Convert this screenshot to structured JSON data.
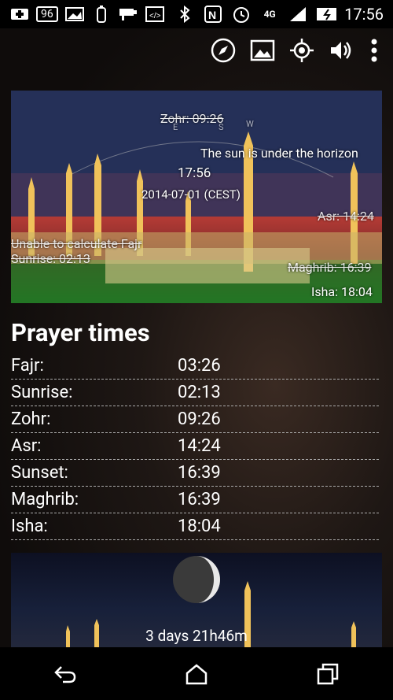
{
  "status_bar": {
    "battery_level": "96",
    "network": "4G",
    "time": "17:56",
    "icons": [
      "plus-icon",
      "battery-level-icon",
      "image-icon",
      "battery-icon",
      "cctv-icon",
      "code-icon",
      "bluetooth-icon",
      "nfc-icon",
      "alarm-icon",
      "network-4g-icon",
      "signal-icon",
      "battery-charging-icon"
    ]
  },
  "action_bar": {
    "icons": [
      "compass-icon",
      "image-icon",
      "location-icon",
      "volume-icon",
      "overflow-menu-icon"
    ]
  },
  "hero": {
    "zohr": "Zohr: 09:26",
    "compass_e": "E",
    "compass_s": "S",
    "compass_w": "W",
    "sun_status": "The sun is under the horizon",
    "time": "17:56",
    "date": "2014-07-01 (CEST)",
    "asr": "Asr: 14:24",
    "fajr_error": "Unable to calculate Fajr",
    "sunrise": "Sunrise: 02:13",
    "maghrib": "Maghrib: 16:39",
    "isha": "Isha: 18:04"
  },
  "prayer_times": {
    "title": "Prayer times",
    "rows": [
      {
        "name": "Fajr:",
        "time": "03:26"
      },
      {
        "name": "Sunrise:",
        "time": "02:13"
      },
      {
        "name": "Zohr:",
        "time": "09:26"
      },
      {
        "name": "Asr:",
        "time": "14:24"
      },
      {
        "name": "Sunset:",
        "time": "16:39"
      },
      {
        "name": "Maghrib:",
        "time": "16:39"
      },
      {
        "name": "Isha:",
        "time": "18:04"
      }
    ]
  },
  "moon": {
    "countdown": "3  days 21h46m"
  },
  "colors": {
    "status_bg": "#000000",
    "text": "#ffffff",
    "divider": "#aaaaaa"
  }
}
